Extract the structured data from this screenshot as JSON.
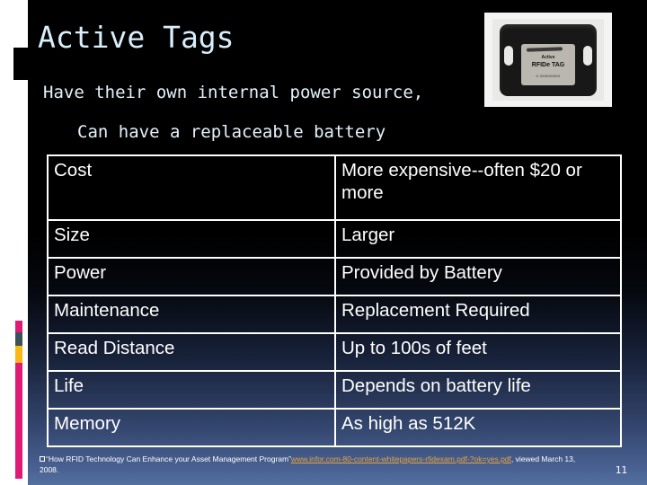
{
  "slide": {
    "title": "Active Tags",
    "page_number": "11",
    "bullets": [
      "Have their own internal power source,",
      "Can have a replaceable battery"
    ],
    "accent_colors": {
      "title_text": "#d9eefb",
      "body_text": "#e4f1fb",
      "deco_pink": "#e01b75",
      "deco_teal": "#3c5058",
      "deco_yellow": "#fbb713",
      "url_link": "#e8a33d",
      "table_border": "#ffffff",
      "background_top": "#000000",
      "background_bottom": "#54709f"
    }
  },
  "photo": {
    "caption_line1": "Active",
    "caption_line2": "RFIDe TAG",
    "caption_line3": "0 000000000"
  },
  "table": {
    "rows": [
      {
        "label": "Cost",
        "value": "More expensive--often $20 or more"
      },
      {
        "label": "Size",
        "value": "Larger"
      },
      {
        "label": "Power",
        "value": "Provided by Battery"
      },
      {
        "label": "Maintenance",
        "value": "Replacement Required"
      },
      {
        "label": "Read Distance",
        "value": "Up to 100s of feet"
      },
      {
        "label": "Life",
        "value": "Depends on battery life"
      },
      {
        "label": "Memory",
        "value": "As high as 512K"
      }
    ]
  },
  "footer": {
    "citation_prefix": "“How RFID Technology Can Enhance your Asset Management Program”",
    "url": "www.infor.com-80-content-whitepapers-rfidexam.pdf-?ok=yes.pdf",
    "suffix": ", viewed March 13, 2008."
  }
}
